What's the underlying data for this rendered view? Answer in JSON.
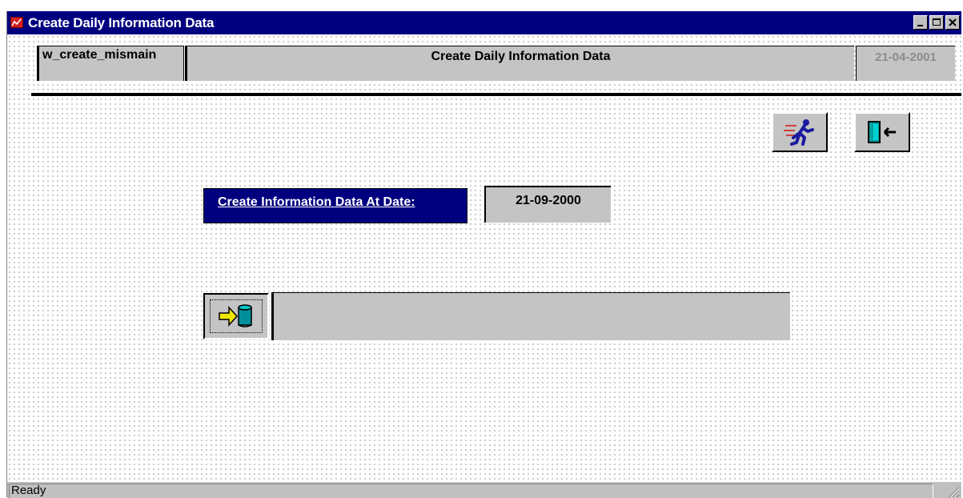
{
  "window": {
    "title": "Create Daily Information Data",
    "icon": "app-chart-icon",
    "controls": [
      "minimize-icon",
      "maximize-icon",
      "close-icon"
    ]
  },
  "header": {
    "window_name": "w_create_mismain",
    "title": "Create Daily Information Data",
    "date": "21-04-2001"
  },
  "toolbar": {
    "run_icon": "running-man-icon",
    "exit_icon": "exit-door-icon"
  },
  "form": {
    "date_label": "Create Information Data At Date:",
    "date_value": "21-09-2000",
    "process_icon": "arrow-to-database-icon",
    "progress_percent": 0
  },
  "status": {
    "text": "Ready"
  },
  "colors": {
    "title_bar": "#00007f",
    "face": "#c4c4c4",
    "label_bg": "#00007f"
  }
}
